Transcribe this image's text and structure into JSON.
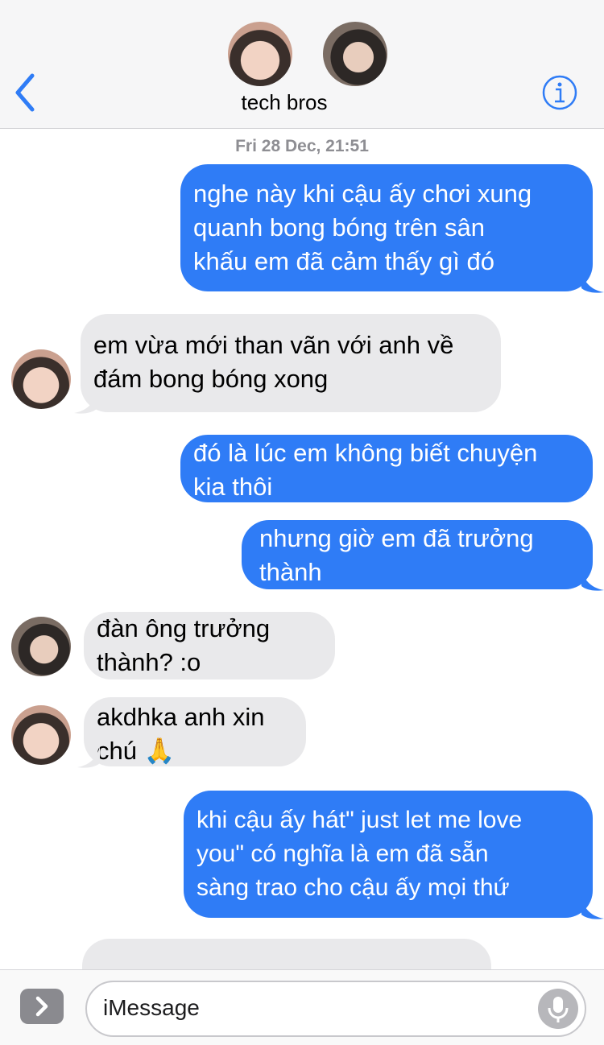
{
  "header": {
    "title": "tech bros",
    "back_icon": "chevron-left-icon",
    "info_icon": "info-icon",
    "accent_color": "#2f7cf6"
  },
  "timestamp": "Fri 28 Dec, 21:51",
  "messages": [
    {
      "dir": "out",
      "text": "nghe này khi cậu ấy chơi xung\nquanh bong bóng trên sân\nkhấu em đã cảm thấy gì đó"
    },
    {
      "dir": "in",
      "sender": "a",
      "text": "em vừa mới than vãn với anh về\nđám bong bóng xong"
    },
    {
      "dir": "out",
      "text": "đó là lúc em không biết chuyện\nkia thôi"
    },
    {
      "dir": "out",
      "text": "nhưng giờ em đã trưởng\nthành"
    },
    {
      "dir": "in",
      "sender": "b",
      "text": "đàn ông trưởng\nthành? :o"
    },
    {
      "dir": "in",
      "sender": "a",
      "text": "akdhka anh xin\nchú 🙏"
    },
    {
      "dir": "out",
      "text": "khi cậu ấy hát\" just let me love\nyou\" có nghĩa là em đã sẵn\nsàng trao cho cậu ấy mọi thứ"
    }
  ],
  "composer": {
    "placeholder": "iMessage",
    "apps_icon": "apps-chevron-icon",
    "mic_icon": "microphone-icon"
  },
  "colors": {
    "outgoing_bubble": "#2f7cf6",
    "incoming_bubble": "#e9e9eb",
    "header_bg": "#f6f6f7"
  }
}
